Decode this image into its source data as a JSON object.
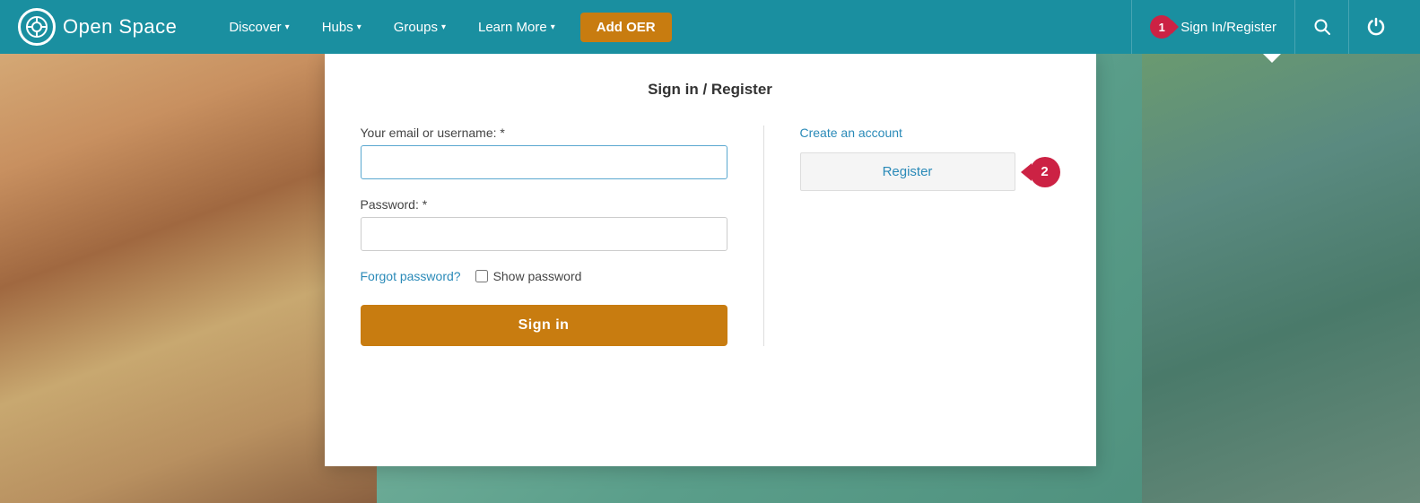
{
  "brand": {
    "logo_icon": "⊙",
    "name": "pen Space"
  },
  "navbar": {
    "nav_items": [
      {
        "label": "Discover",
        "has_dropdown": true
      },
      {
        "label": "Hubs",
        "has_dropdown": true
      },
      {
        "label": "Groups",
        "has_dropdown": true
      },
      {
        "label": "Learn More",
        "has_dropdown": true
      }
    ],
    "add_oer_label": "Add OER",
    "signin_label": "Sign In/Register",
    "badge1_number": "1",
    "badge2_number": "2"
  },
  "login_panel": {
    "title": "Sign in / Register",
    "email_label": "Your email or username: *",
    "email_placeholder": "",
    "password_label": "Password: *",
    "password_placeholder": "",
    "forgot_label": "Forgot password?",
    "show_password_label": "Show password",
    "sign_in_button": "Sign in",
    "create_account_label": "Create an account",
    "register_button": "Register"
  }
}
